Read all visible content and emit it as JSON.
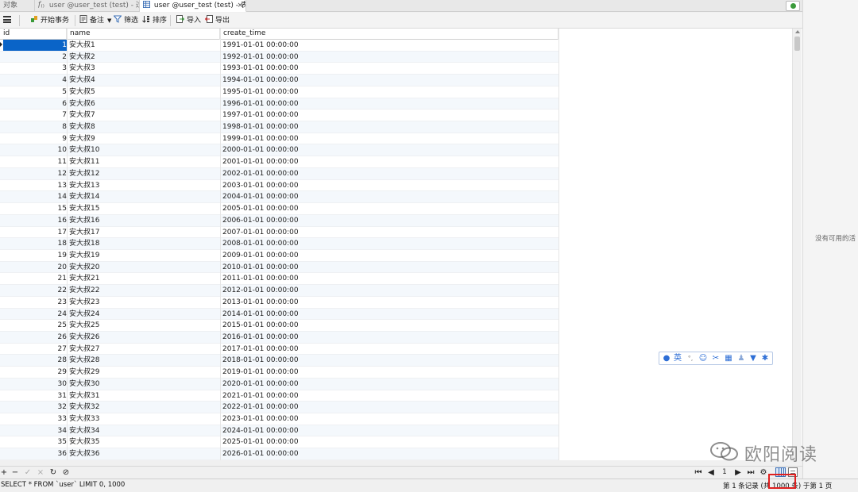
{
  "tabs": [
    {
      "label": "对象",
      "icon": "none"
    },
    {
      "label": "user @user_test (test) - 过程",
      "icon": "function-icon"
    },
    {
      "label": "user @user_test (test) - 表",
      "icon": "table-icon",
      "active": true
    }
  ],
  "side_panel": {
    "message": "没有可用的活"
  },
  "toolbar": {
    "begin_transaction": "开始事务",
    "memo": "备注",
    "filter": "筛选",
    "sort": "排序",
    "import": "导入",
    "export": "导出"
  },
  "grid": {
    "columns": [
      "id",
      "name",
      "create_time"
    ],
    "rows": [
      [
        "1",
        "安大叔1",
        "1991-01-01 00:00:00"
      ],
      [
        "2",
        "安大叔2",
        "1992-01-01 00:00:00"
      ],
      [
        "3",
        "安大叔3",
        "1993-01-01 00:00:00"
      ],
      [
        "4",
        "安大叔4",
        "1994-01-01 00:00:00"
      ],
      [
        "5",
        "安大叔5",
        "1995-01-01 00:00:00"
      ],
      [
        "6",
        "安大叔6",
        "1996-01-01 00:00:00"
      ],
      [
        "7",
        "安大叔7",
        "1997-01-01 00:00:00"
      ],
      [
        "8",
        "安大叔8",
        "1998-01-01 00:00:00"
      ],
      [
        "9",
        "安大叔9",
        "1999-01-01 00:00:00"
      ],
      [
        "10",
        "安大叔10",
        "2000-01-01 00:00:00"
      ],
      [
        "11",
        "安大叔11",
        "2001-01-01 00:00:00"
      ],
      [
        "12",
        "安大叔12",
        "2002-01-01 00:00:00"
      ],
      [
        "13",
        "安大叔13",
        "2003-01-01 00:00:00"
      ],
      [
        "14",
        "安大叔14",
        "2004-01-01 00:00:00"
      ],
      [
        "15",
        "安大叔15",
        "2005-01-01 00:00:00"
      ],
      [
        "16",
        "安大叔16",
        "2006-01-01 00:00:00"
      ],
      [
        "17",
        "安大叔17",
        "2007-01-01 00:00:00"
      ],
      [
        "18",
        "安大叔18",
        "2008-01-01 00:00:00"
      ],
      [
        "19",
        "安大叔19",
        "2009-01-01 00:00:00"
      ],
      [
        "20",
        "安大叔20",
        "2010-01-01 00:00:00"
      ],
      [
        "21",
        "安大叔21",
        "2011-01-01 00:00:00"
      ],
      [
        "22",
        "安大叔22",
        "2012-01-01 00:00:00"
      ],
      [
        "23",
        "安大叔23",
        "2013-01-01 00:00:00"
      ],
      [
        "24",
        "安大叔24",
        "2014-01-01 00:00:00"
      ],
      [
        "25",
        "安大叔25",
        "2015-01-01 00:00:00"
      ],
      [
        "26",
        "安大叔26",
        "2016-01-01 00:00:00"
      ],
      [
        "27",
        "安大叔27",
        "2017-01-01 00:00:00"
      ],
      [
        "28",
        "安大叔28",
        "2018-01-01 00:00:00"
      ],
      [
        "29",
        "安大叔29",
        "2019-01-01 00:00:00"
      ],
      [
        "30",
        "安大叔30",
        "2020-01-01 00:00:00"
      ],
      [
        "31",
        "安大叔31",
        "2021-01-01 00:00:00"
      ],
      [
        "32",
        "安大叔32",
        "2022-01-01 00:00:00"
      ],
      [
        "33",
        "安大叔33",
        "2023-01-01 00:00:00"
      ],
      [
        "34",
        "安大叔34",
        "2024-01-01 00:00:00"
      ],
      [
        "35",
        "安大叔35",
        "2025-01-01 00:00:00"
      ],
      [
        "36",
        "安大叔36",
        "2026-01-01 00:00:00"
      ]
    ],
    "selected_row": 0
  },
  "pager": {
    "page": "1"
  },
  "status": {
    "sql": "SELECT * FROM `user` LIMIT 0, 1000",
    "records": "第 1 条记录 (共 1000 条) 于第 1 页"
  },
  "ime": {
    "lang": "英"
  },
  "watermark": {
    "text": "欧阳阅读"
  },
  "colors": {
    "selection": "#0a64c8",
    "highlight_box": "#e02020",
    "ime_blue": "#2d6ed6"
  }
}
